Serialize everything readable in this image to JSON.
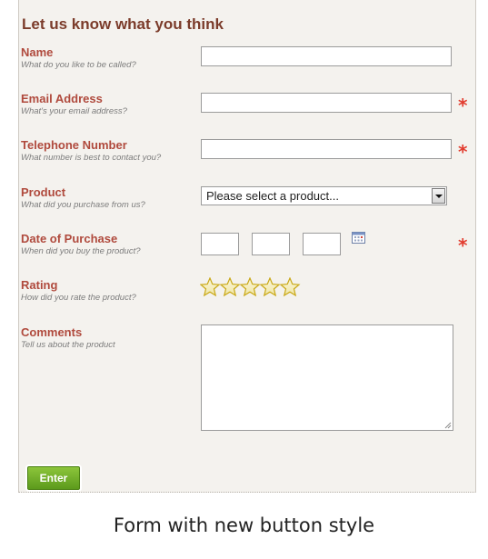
{
  "form": {
    "title": "Let us know what you think",
    "fields": [
      {
        "label": "Name",
        "hint": "What do you like to be called?",
        "value": "",
        "required": false
      },
      {
        "label": "Email Address",
        "hint": "What's your email address?",
        "value": "",
        "required": true
      },
      {
        "label": "Telephone Number",
        "hint": "What number is best to contact you?",
        "value": "",
        "required": true
      },
      {
        "label": "Product",
        "hint": "What did you purchase from us?",
        "selected": "Please select a product...",
        "required": false
      },
      {
        "label": "Date of Purchase",
        "hint": "When did you buy the product?",
        "day": "",
        "month": "",
        "year": "",
        "required": true
      },
      {
        "label": "Rating",
        "hint": "How did you rate the product?",
        "rating": 0,
        "max_rating": 5,
        "required": false
      },
      {
        "label": "Comments",
        "hint": "Tell us about the product",
        "value": "",
        "required": false
      }
    ],
    "required_marker": "*",
    "submit_label": "Enter"
  },
  "caption": "Form with new button style",
  "colors": {
    "label": "#b04a3d",
    "title": "#7b3b2a",
    "required": "#e23c2e",
    "button": "#6aa822",
    "panel": "#f4f2ee"
  },
  "icons": {
    "required": "asterisk-icon",
    "date": "calendar-icon",
    "rating": "star-icon",
    "select": "dropdown-arrow-icon"
  }
}
